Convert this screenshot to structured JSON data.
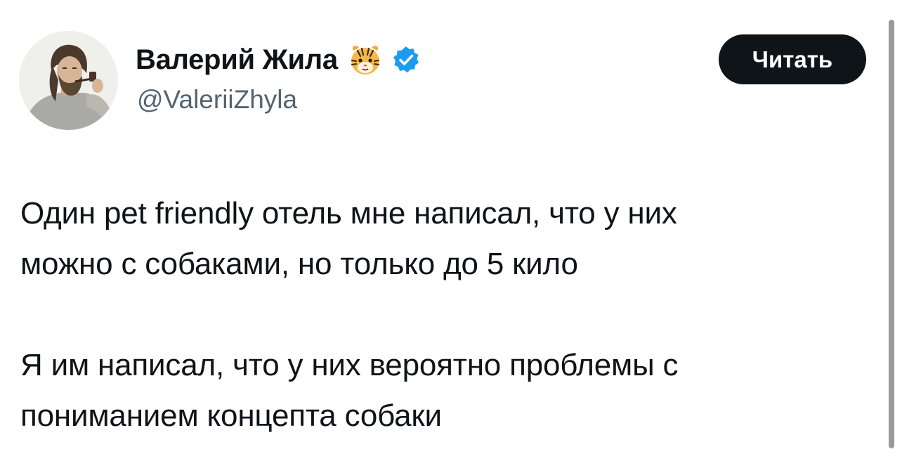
{
  "author": {
    "display_name": "Валерий Жила",
    "handle": "@ValeriiZhyla",
    "badge_icon": "tiger-face-emoji",
    "verified_icon": "verified-badge-icon",
    "verified_color": "#1d9bf0"
  },
  "actions": {
    "follow_label": "Читать"
  },
  "tweet": {
    "paragraph_1_line_1": "Один pet friendly отель мне написал, что у них",
    "paragraph_1_line_2": "можно с собаками, но только до 5 кило",
    "paragraph_2_line_1": "Я им написал, что у них вероятно проблемы с",
    "paragraph_2_line_2": "пониманием концепта собаки"
  },
  "colors": {
    "text": "#0f1419",
    "secondary_text": "#536471",
    "button_bg": "#0f1419",
    "button_text": "#ffffff"
  }
}
